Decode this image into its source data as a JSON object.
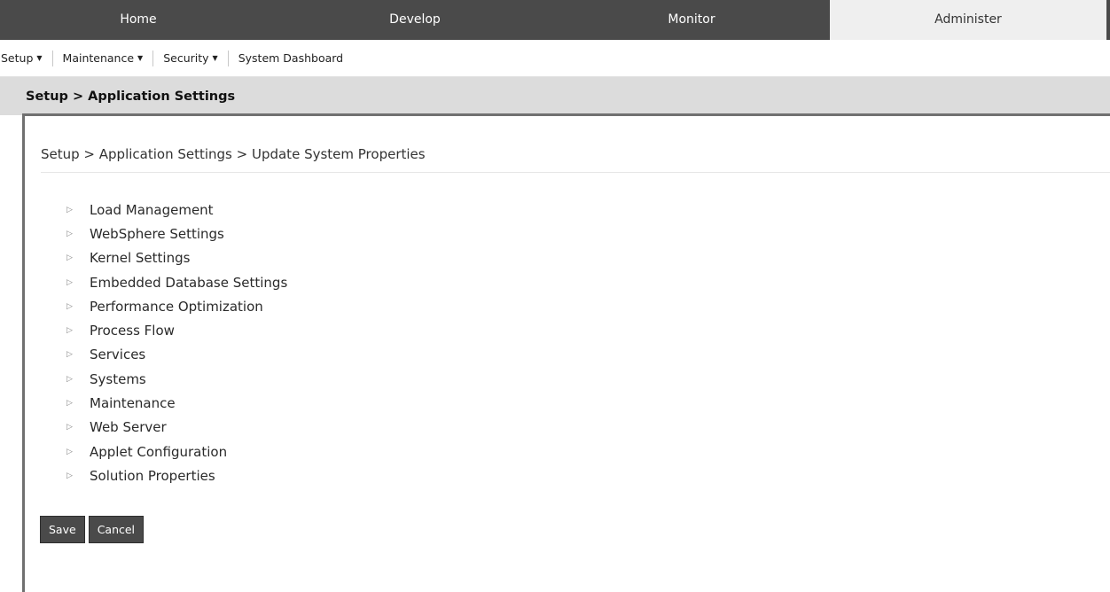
{
  "topnav": {
    "tabs": [
      {
        "label": "Home"
      },
      {
        "label": "Develop"
      },
      {
        "label": "Monitor"
      },
      {
        "label": "Administer"
      }
    ]
  },
  "subnav": {
    "items": [
      {
        "label": "Setup"
      },
      {
        "label": "Maintenance"
      },
      {
        "label": "Security"
      },
      {
        "label": "System Dashboard"
      }
    ]
  },
  "page": {
    "title": "Setup > Application Settings",
    "breadcrumb": "Setup > Application Settings > Update System Properties"
  },
  "sections": [
    "Load Management",
    "WebSphere Settings",
    "Kernel Settings",
    "Embedded Database Settings",
    "Performance Optimization",
    "Process Flow",
    "Services",
    "Systems",
    "Maintenance",
    "Web Server",
    "Applet Configuration",
    "Solution Properties"
  ],
  "buttons": {
    "save": "Save",
    "cancel": "Cancel"
  }
}
